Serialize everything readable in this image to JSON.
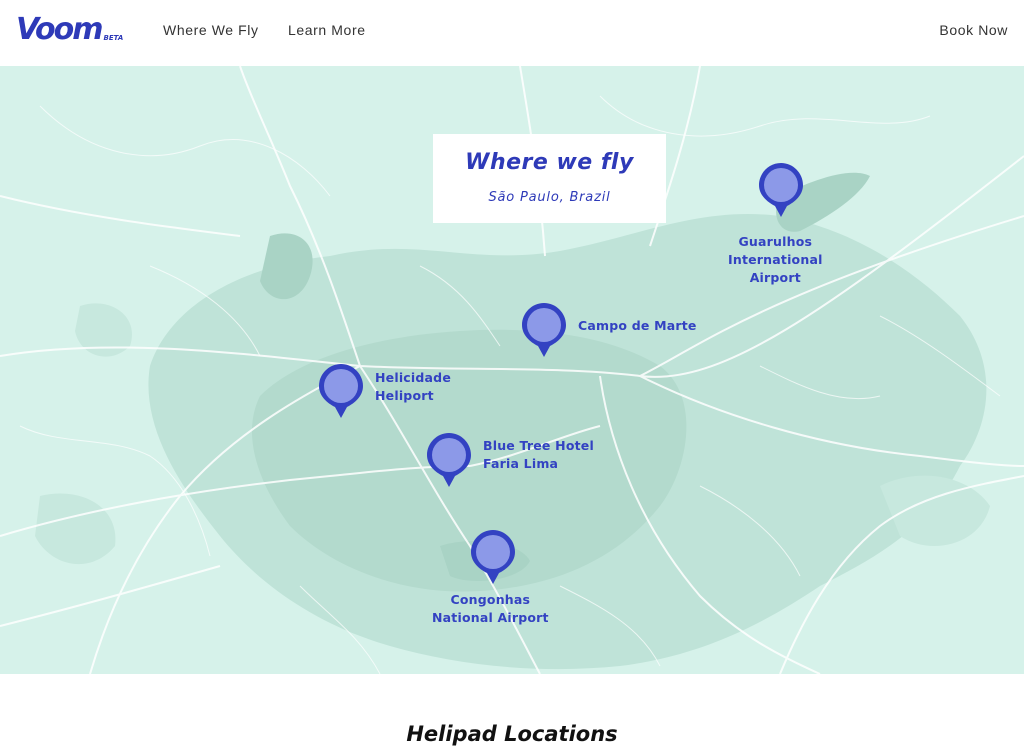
{
  "header": {
    "logo": "Voom",
    "logo_badge": "BETA",
    "nav": {
      "where_we_fly": "Where We Fly",
      "learn_more": "Learn More",
      "book_now": "Book Now"
    }
  },
  "map": {
    "title": "Where we fly",
    "subtitle": "São Paulo, Brazil",
    "colors": {
      "background": "#d6f2ea",
      "urban": "#b8ddd2",
      "roads": "#ffffff",
      "pin": "#3342c2",
      "pin_fill": "#8c99e8"
    },
    "locations": [
      {
        "id": "guarulhos",
        "lines": [
          "Guarulhos",
          "International",
          "Airport"
        ],
        "icon": "map-pin-icon"
      },
      {
        "id": "campo-de-marte",
        "lines": [
          "Campo de Marte"
        ],
        "icon": "map-pin-icon"
      },
      {
        "id": "helicidade",
        "lines": [
          "Helicidade",
          "Heliport"
        ],
        "icon": "map-pin-icon"
      },
      {
        "id": "blue-tree",
        "lines": [
          "Blue Tree Hotel",
          "Faria Lima"
        ],
        "icon": "map-pin-icon"
      },
      {
        "id": "congonhas",
        "lines": [
          "Congonhas",
          "National Airport"
        ],
        "icon": "map-pin-icon"
      }
    ]
  },
  "section": {
    "title": "Helipad Locations"
  }
}
